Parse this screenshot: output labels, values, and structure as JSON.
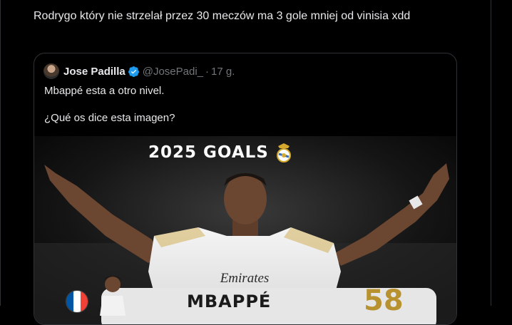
{
  "tweet": {
    "text": "Rodrygo który nie strzelał przez 30 meczów ma 3 gole mniej od vinisia xdd"
  },
  "quote": {
    "author_name": "Jose Padilla",
    "handle": "@JosePadi_",
    "separator": "·",
    "time": "17 g.",
    "text": "Mbappé esta a otro nivel.\n\n¿Qué os dice esta imagen?",
    "image": {
      "title": "2025 GOALS",
      "player_name": "MBAPPÉ",
      "goals": "58",
      "sponsor": "Emirates"
    }
  },
  "colors": {
    "background": "#000000",
    "border": "#2f3336",
    "text_primary": "#e7e9ea",
    "text_secondary": "#71767b",
    "verified_blue": "#1d9bf0",
    "gold": "#b8922e"
  },
  "icons": {
    "verified": "verified-badge-icon",
    "crest": "real-madrid-crest-icon",
    "flag": "france-flag-icon"
  }
}
